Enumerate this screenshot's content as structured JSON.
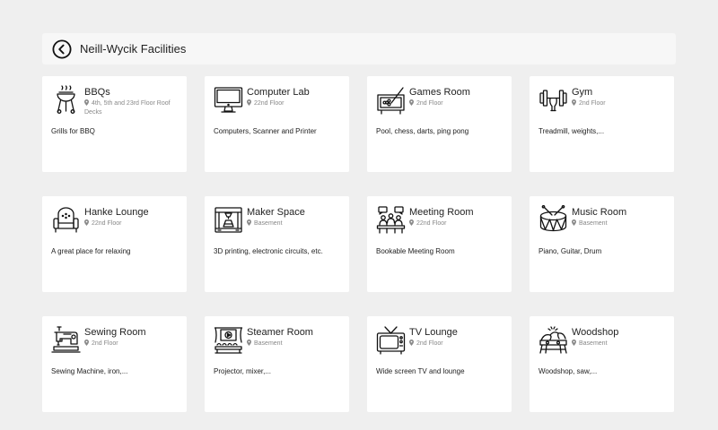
{
  "header": {
    "title": "Neill-Wycik Facilities",
    "back_icon": "back-arrow-circle-icon"
  },
  "facilities": [
    {
      "name": "BBQs",
      "location": "4th, 5th and 23rd Floor Roof Decks",
      "description": "Grills for BBQ",
      "icon": "bbq-grill-icon"
    },
    {
      "name": "Computer Lab",
      "location": "22nd Floor",
      "description": "Computers, Scanner and Printer",
      "icon": "computer-monitor-icon"
    },
    {
      "name": "Games Room",
      "location": "2nd Floor",
      "description": "Pool, chess, darts, ping pong",
      "icon": "pool-table-icon"
    },
    {
      "name": "Gym",
      "location": "2nd Floor",
      "description": "Treadmill, weights,...",
      "icon": "dumbbell-icon"
    },
    {
      "name": "Hanke Lounge",
      "location": "22nd Floor",
      "description": "A great place for relaxing",
      "icon": "armchair-icon"
    },
    {
      "name": "Maker Space",
      "location": "Basement",
      "description": "3D printing, electronic circuits, etc.",
      "icon": "3d-printer-icon"
    },
    {
      "name": "Meeting Room",
      "location": "22nd Floor",
      "description": "Bookable Meeting Room",
      "icon": "meeting-table-icon"
    },
    {
      "name": "Music Room",
      "location": "Basement",
      "description": "Piano, Guitar, Drum",
      "icon": "drum-icon"
    },
    {
      "name": "Sewing Room",
      "location": "2nd Floor",
      "description": "Sewing Machine, iron,...",
      "icon": "sewing-machine-icon"
    },
    {
      "name": "Steamer Room",
      "location": "Basement",
      "description": "Projector, mixer,...",
      "icon": "cinema-screen-icon"
    },
    {
      "name": "TV Lounge",
      "location": "2nd Floor",
      "description": "Wide screen TV and lounge",
      "icon": "tv-icon"
    },
    {
      "name": "Woodshop",
      "location": "Basement",
      "description": "Woodshop, saw,...",
      "icon": "woodworking-icon"
    }
  ]
}
